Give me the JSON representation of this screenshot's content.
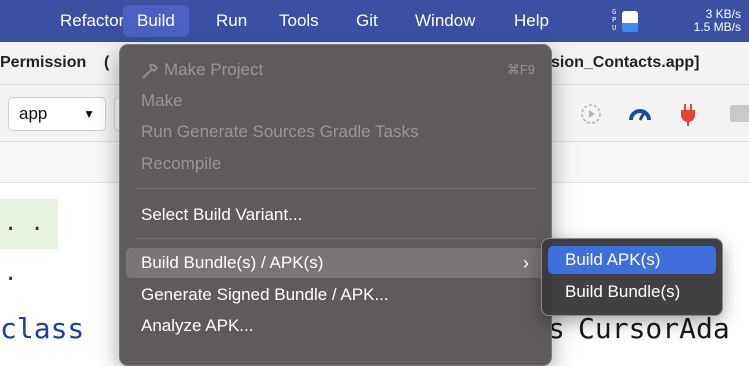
{
  "menubar": {
    "items": [
      {
        "label": "Refactor"
      },
      {
        "label": "Build"
      },
      {
        "label": "Run"
      },
      {
        "label": "Tools"
      },
      {
        "label": "Git"
      },
      {
        "label": "Window"
      },
      {
        "label": "Help"
      }
    ],
    "gpu_label": "G\nP\nU",
    "gpu_usage_fraction": 0.45,
    "net_up": "3 KB/s",
    "net_down": "1.5 MB/s"
  },
  "ide": {
    "title_left": "Permission",
    "title_left_cut": "(",
    "title_right": "sion_Contacts.app]",
    "config_value": "app",
    "dots": ". . .",
    "code_left": "class",
    "code_right_prefix": "s",
    "code_right": "CursorAda"
  },
  "build_menu": {
    "items": [
      {
        "label": "Make Project",
        "shortcut": "⌘F9",
        "disabled": true
      },
      {
        "label": "Make",
        "disabled": true
      },
      {
        "label": "Run Generate Sources Gradle Tasks",
        "disabled": true
      },
      {
        "label": "Recompile",
        "disabled": true
      },
      {
        "label": "Select Build Variant..."
      },
      {
        "label": "Build Bundle(s) / APK(s)",
        "highlighted": true
      },
      {
        "label": "Generate Signed Bundle / APK..."
      },
      {
        "label": "Analyze APK..."
      }
    ]
  },
  "submenu": {
    "items": [
      {
        "label": "Build APK(s)",
        "selected": true
      },
      {
        "label": "Build Bundle(s)"
      }
    ]
  },
  "colors": {
    "menubar_bg": "#3b50a3",
    "active_highlight": "#4a61c4",
    "submenu_selected": "#3f6fdc"
  }
}
